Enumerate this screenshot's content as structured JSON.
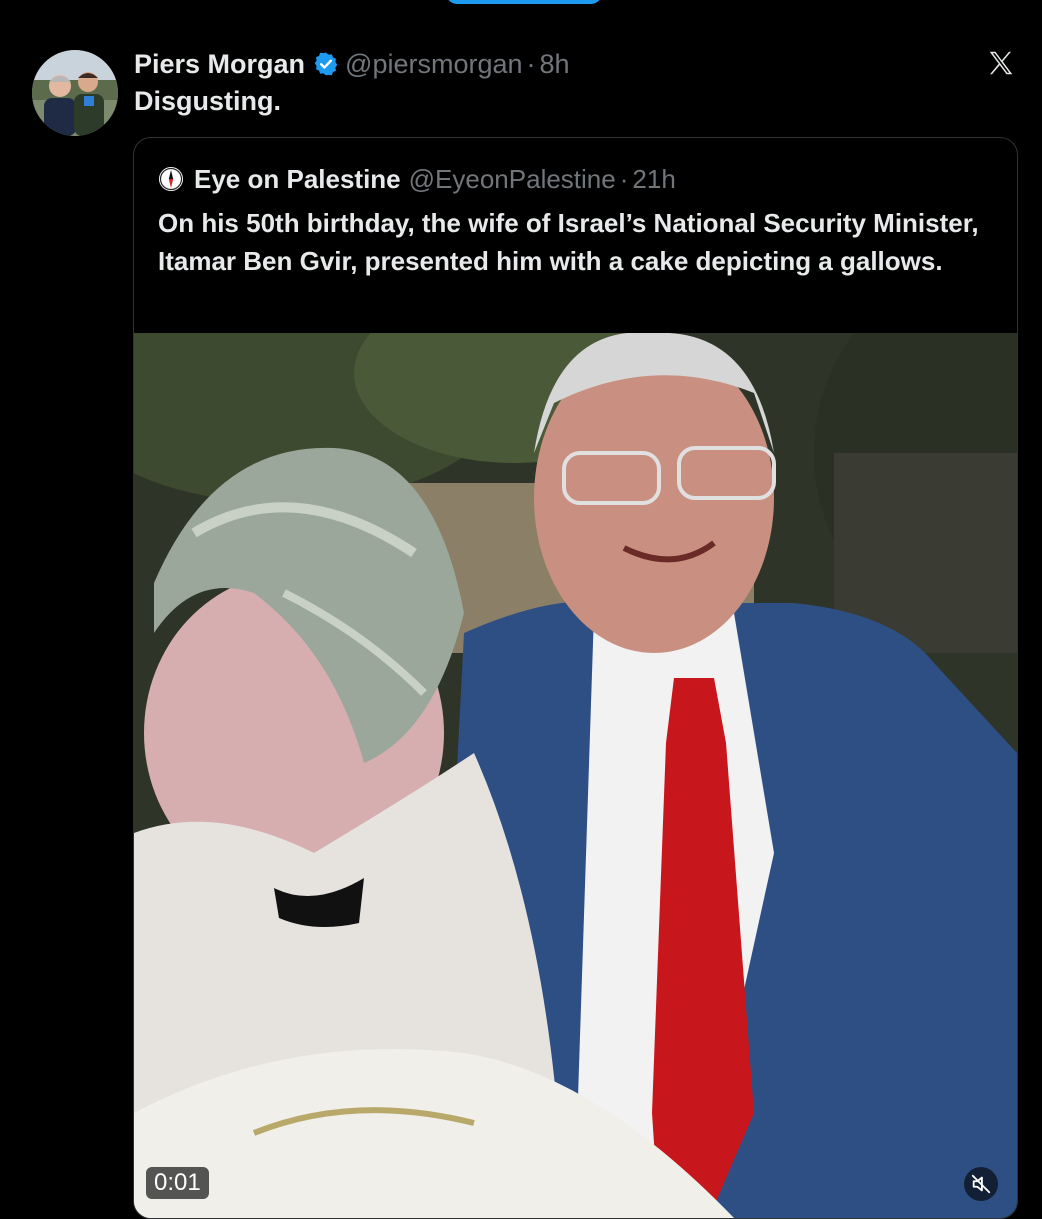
{
  "tweet": {
    "author_name": "Piers Morgan",
    "handle": "@piersmorgan",
    "separator": "·",
    "time": "8h",
    "text": "Disgusting.",
    "verified_icon": "verified-badge-icon",
    "close_icon": "x-logo-icon"
  },
  "quote": {
    "author_name": "Eye on Palestine",
    "handle": "@EyeonPalestine",
    "separator": "·",
    "time": "21h",
    "text": "On his 50th birthday, the wife of Israel’s National Security Minister, Itamar Ben Gvir, presented him with a cake depicting a gallows.",
    "avatar_icon": "compass-icon"
  },
  "video": {
    "timestamp": "0:01",
    "mute_icon": "speaker-muted-icon"
  },
  "colors": {
    "background": "#000000",
    "primary_text": "#e7e9ea",
    "secondary_text": "#71767b",
    "border": "#2f3336",
    "verified_blue": "#1d9bf0"
  }
}
